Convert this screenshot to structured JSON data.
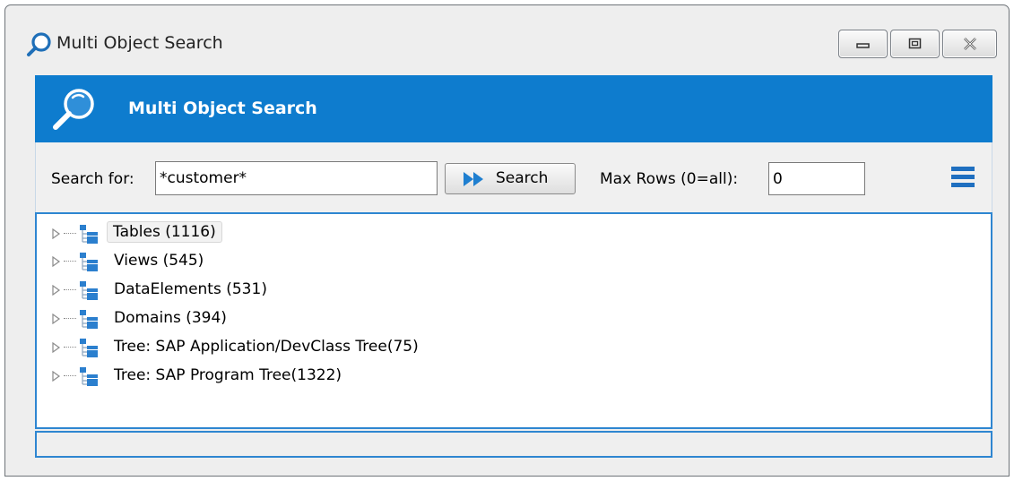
{
  "window": {
    "title": "Multi Object Search",
    "colors": {
      "header": "#0e7cce",
      "border": "#2e86d1"
    }
  },
  "header": {
    "title": "Multi Object Search",
    "icon": "magnifier-icon"
  },
  "toolbar": {
    "search_label": "Search for:",
    "search_value": "*customer*",
    "search_button": "Search",
    "maxrows_label": "Max Rows (0=all):",
    "maxrows_value": "0",
    "menu_icon": "hamburger-menu-icon"
  },
  "tree": {
    "items": [
      {
        "label": "Tables (1116)",
        "selected": true
      },
      {
        "label": "Views (545)"
      },
      {
        "label": "DataElements (531)"
      },
      {
        "label": "Domains (394)"
      },
      {
        "label": "Tree: SAP Application/DevClass Tree(75)"
      },
      {
        "label": "Tree: SAP Program Tree(1322)"
      }
    ]
  },
  "statusbar": {
    "text": ""
  }
}
